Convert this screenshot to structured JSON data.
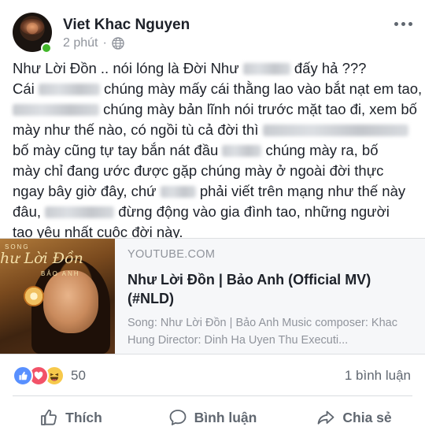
{
  "post": {
    "author": "Viet Khac Nguyen",
    "time": "2 phút",
    "privacy_icon": "globe-icon",
    "more_icon": "more-options-icon",
    "text_lines": [
      [
        "Như Lời Đồn ..  nói lóng là Đời Như ",
        null,
        " đấy hả ???"
      ],
      [
        "Cái ",
        null,
        " chúng mày mấy cái thằng lao vào bắt nạt  em tao,"
      ],
      [
        null,
        " chúng mày bản lĩnh nói trước mặt tao đi, xem bố"
      ],
      [
        "mày như thế nào, có ngồi tù cả đời thì ",
        null
      ],
      [
        "bố mày cũng tự tay bắn nát đầu ",
        null,
        " chúng mày ra, bố"
      ],
      [
        "mày chỉ đang ước được gặp chúng mày ở ngoài đời thực"
      ],
      [
        "ngay bây giờ đây, chứ ",
        null,
        " phải viết trên mạng như thế này"
      ],
      [
        "đâu, ",
        null,
        " đừng động vào gia đình tao,  những người"
      ],
      [
        "tao yêu nhất cuộc đời này."
      ]
    ]
  },
  "link_card": {
    "thumbnail_text": {
      "song": "SONG",
      "title": "hư Lời Đồn",
      "artist": "BẢO ANH"
    },
    "source": "YOUTUBE.COM",
    "title": "Như Lời Đồn | Bảo Anh (Official MV) (#NLD)",
    "description": "Song: Như Lời Đồn | Bảo Anh Music composer: Khac Hung Director: Dinh Ha Uyen Thu Executi..."
  },
  "reactions": {
    "icons": [
      "like-icon",
      "love-icon",
      "haha-icon"
    ],
    "count": "50",
    "comments": "1 bình luận"
  },
  "actions": {
    "like": "Thích",
    "comment": "Bình luận",
    "share": "Chia sẻ"
  },
  "colors": {
    "text": "#1d2129",
    "secondary": "#90949c",
    "action": "#606770",
    "like_blue": "#5890ff",
    "love_red": "#f25268",
    "haha_yellow": "#f7c94b",
    "online_green": "#42b72a"
  }
}
